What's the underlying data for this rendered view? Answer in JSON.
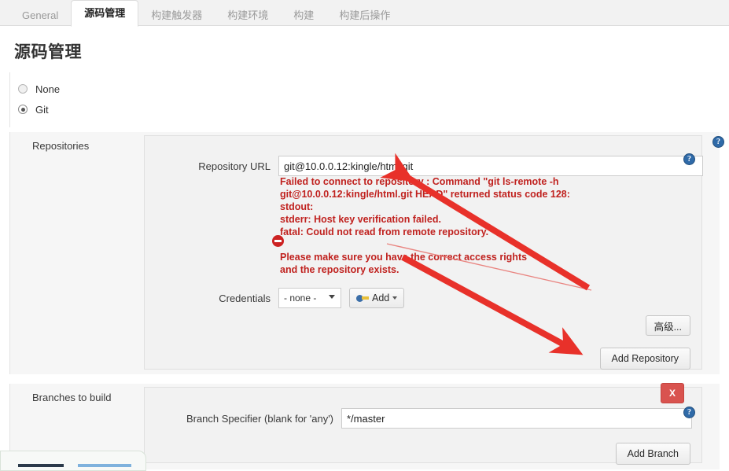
{
  "tabs": [
    {
      "label": "General",
      "active": false
    },
    {
      "label": "源码管理",
      "active": true
    },
    {
      "label": "构建触发器",
      "active": false
    },
    {
      "label": "构建环境",
      "active": false
    },
    {
      "label": "构建",
      "active": false
    },
    {
      "label": "构建后操作",
      "active": false
    }
  ],
  "page": {
    "title": "源码管理"
  },
  "scm": {
    "options": [
      {
        "label": "None",
        "checked": false
      },
      {
        "label": "Git",
        "checked": true
      }
    ]
  },
  "repositories": {
    "section_label": "Repositories",
    "repository_url": {
      "label": "Repository URL",
      "value": "git@10.0.0.12:kingle/html.git",
      "placeholder": ""
    },
    "error": {
      "line1": "Failed to connect to repository : Command \"git ls-remote -h\ngit@10.0.0.12:kingle/html.git HEAD\" returned status code 128:\nstdout:\nstderr: Host key verification failed.\nfatal: Could not read from remote repository.",
      "line2": "Please make sure you have the correct access rights\nand the repository exists.",
      "icon": "error-no-entry-icon",
      "color": "#c0221f"
    },
    "credentials": {
      "label": "Credentials",
      "selected": "- none -",
      "options": [
        "- none -"
      ],
      "add_button": "Add"
    },
    "advanced_button": "高级...",
    "add_repository_button": "Add Repository"
  },
  "branches": {
    "section_label": "Branches to build",
    "branch_specifier": {
      "label": "Branch Specifier (blank for 'any')",
      "value": "*/master",
      "placeholder": ""
    },
    "delete_button": "X",
    "add_branch_button": "Add Branch"
  },
  "help": {
    "glyph": "?"
  },
  "annotations": {
    "arrow_color": "#e8312a",
    "arrow1": "arrow pointing up-left to Repository URL field",
    "arrow2": "arrow pointing down-right to Add Repository button",
    "thin_line": "thin red underline stroke"
  },
  "colors": {
    "accent_error": "#c0221f",
    "accent_delete": "#d9534f",
    "accent_help": "#2f6aa8",
    "annotation": "#e8312a"
  }
}
